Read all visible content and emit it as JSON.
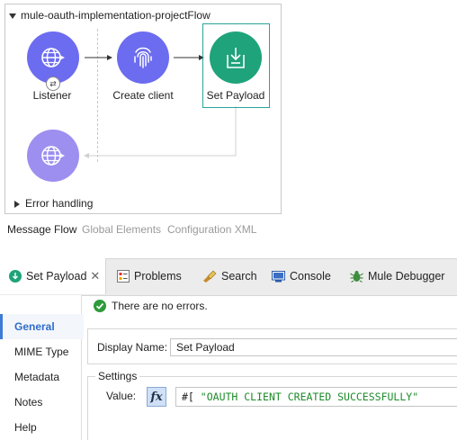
{
  "flow": {
    "title": "mule-oauth-implementation-projectFlow",
    "nodes": {
      "listener": "Listener",
      "create_client": "Create client",
      "set_payload": "Set Payload"
    },
    "error_handling": "Error handling"
  },
  "editor_tabs": [
    "Message Flow",
    "Global Elements",
    "Configuration XML"
  ],
  "panel_tabs": {
    "set_payload": "Set Payload",
    "problems": "Problems",
    "search": "Search",
    "console": "Console",
    "mule_debugger": "Mule Debugger"
  },
  "status": "There are no errors.",
  "sidebar": [
    "General",
    "MIME Type",
    "Metadata",
    "Notes",
    "Help"
  ],
  "form": {
    "display_name_label": "Display Name:",
    "display_name_value": "Set Payload",
    "settings_label": "Settings",
    "value_label": "Value:",
    "fx_label": "fx",
    "expr_prefix": "#[",
    "expr_value": "\"OAUTH CLIENT CREATED SUCCESSFULLY\""
  },
  "colors": {
    "accent": "#6c6cf0",
    "success": "#1fa37a",
    "selection": "#2aa39b",
    "string_literal": "#1d8b2a"
  }
}
